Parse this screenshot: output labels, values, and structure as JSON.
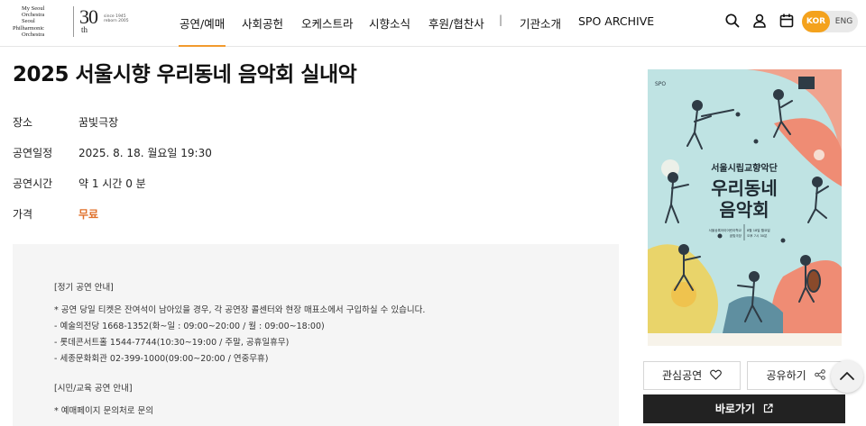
{
  "logo": {
    "line1": "My Seoul",
    "line2": "Orchestra",
    "line3": "Seoul",
    "line4": "Philharmonic",
    "line5": "Orchestra",
    "anniv_number": "30",
    "anniv_suffix": "th",
    "since1": "since 1945",
    "since2": "reborn 2005"
  },
  "nav": {
    "items": [
      "공연/예매",
      "사회공헌",
      "오케스트라",
      "시향소식",
      "후원/협찬사",
      "기관소개",
      "SPO ARCHIVE"
    ],
    "separator": "|",
    "active_index": 0,
    "accent_color": "#f29a2e"
  },
  "header_icons": [
    "search-icon",
    "user-icon",
    "calendar-icon"
  ],
  "lang": {
    "kor": "KOR",
    "eng": "ENG",
    "active": "KOR",
    "active_color": "#f4a21d"
  },
  "concert": {
    "title": "2025 서울시향 우리동네 음악회 실내악",
    "info": [
      {
        "label": "장소",
        "value": "꿈빛극장"
      },
      {
        "label": "공연일정",
        "value": "2025. 8. 18. 월요일 19:30"
      },
      {
        "label": "공연시간",
        "value": "약 1 시간 0 분"
      },
      {
        "label": "가격",
        "value": "무료"
      }
    ],
    "price_color": "#e0712b"
  },
  "notice": {
    "lines": [
      "[정기 공연 안내]",
      "* 공연 당일 티켓은 잔여석이 남아있을 경우, 각 공연장 콜센터와 현장 매표소에서 구입하실 수 있습니다.",
      "- 예술의전당 1668-1352(화~일 : 09:00~20:00 / 월 : 09:00~18:00)",
      "- 롯데콘서트홀 1544-7744(10:30~19:00 / 주말, 공휴일휴무)",
      "- 세종문화회관 02-399-1000(09:00~20:00 / 연중무휴)",
      "[시민/교육 공연 안내]",
      "* 예매페이지 문의처로 문의"
    ]
  },
  "poster": {
    "org": "서울시립교향악단",
    "title_line1": "우리동네",
    "title_line2": "음악회",
    "venue_line1": "서울상록아이어린이학교",
    "venue_line2": "꿈빛극장",
    "date_line1": "8월 18일 월요일",
    "date_line2": "오후 7시 30분",
    "bg_color": "#bfe3e3"
  },
  "actions": {
    "like_label": "관심공연",
    "share_label": "공유하기",
    "go_label": "바로가기"
  }
}
